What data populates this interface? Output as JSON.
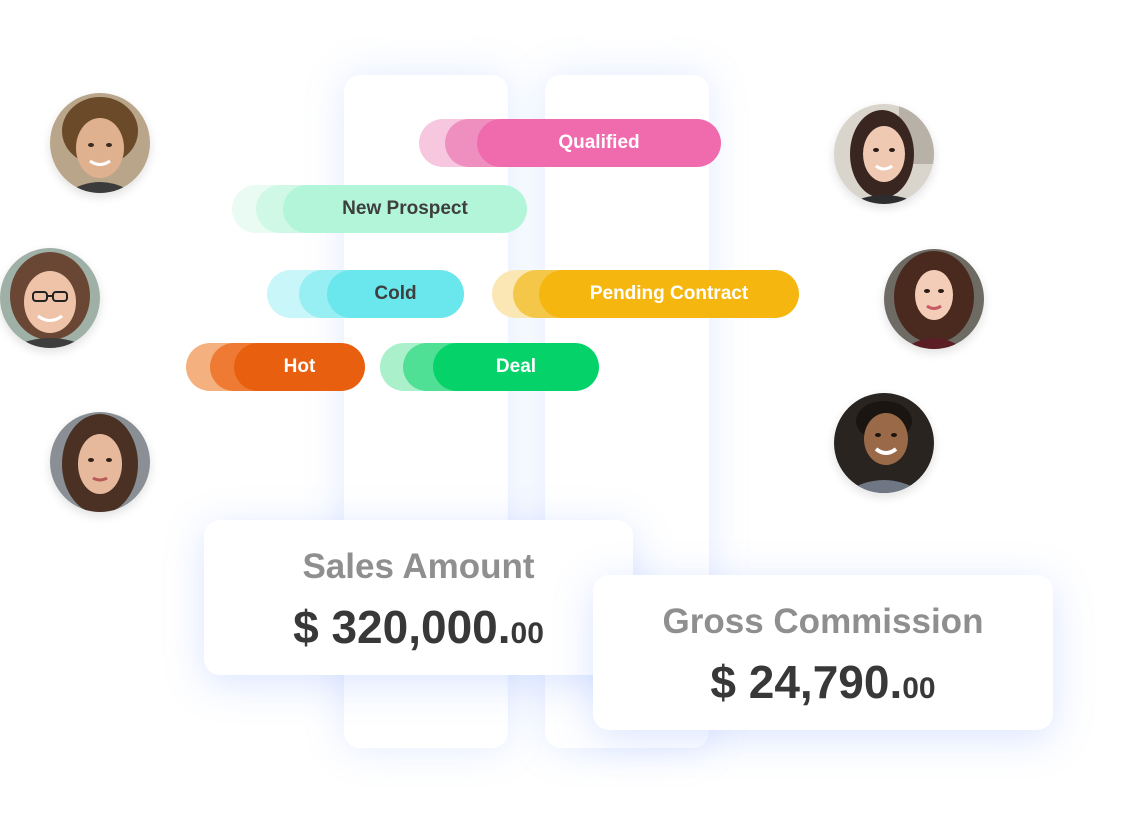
{
  "tags": [
    {
      "label": "Qualified",
      "color": "#f06aae",
      "text_color": "#ffffff"
    },
    {
      "label": "New Prospect",
      "color": "#b3f5d9",
      "text_color": "#3e3e3e"
    },
    {
      "label": "Cold",
      "color": "#6ae6ed",
      "text_color": "#3e3e3e"
    },
    {
      "label": "Pending Contract",
      "color": "#f5b70f",
      "text_color": "#ffffff"
    },
    {
      "label": "Hot",
      "color": "#e8600f",
      "text_color": "#ffffff"
    },
    {
      "label": "Deal",
      "color": "#05d36a",
      "text_color": "#ffffff"
    }
  ],
  "cards": {
    "sales": {
      "label": "Sales Amount",
      "amount_main": "$ 320,000.",
      "amount_cents": "00"
    },
    "commission": {
      "label": "Gross Commission",
      "amount_main": "$ 24,790.",
      "amount_cents": "00"
    }
  },
  "avatars": [
    {
      "name": "avatar-curly-hair-man-icon"
    },
    {
      "name": "avatar-woman-glasses-icon"
    },
    {
      "name": "avatar-woman-long-hair-icon"
    },
    {
      "name": "avatar-woman-dark-hair-icon"
    },
    {
      "name": "avatar-woman-curly-hair-icon"
    },
    {
      "name": "avatar-smiling-man-icon"
    }
  ]
}
